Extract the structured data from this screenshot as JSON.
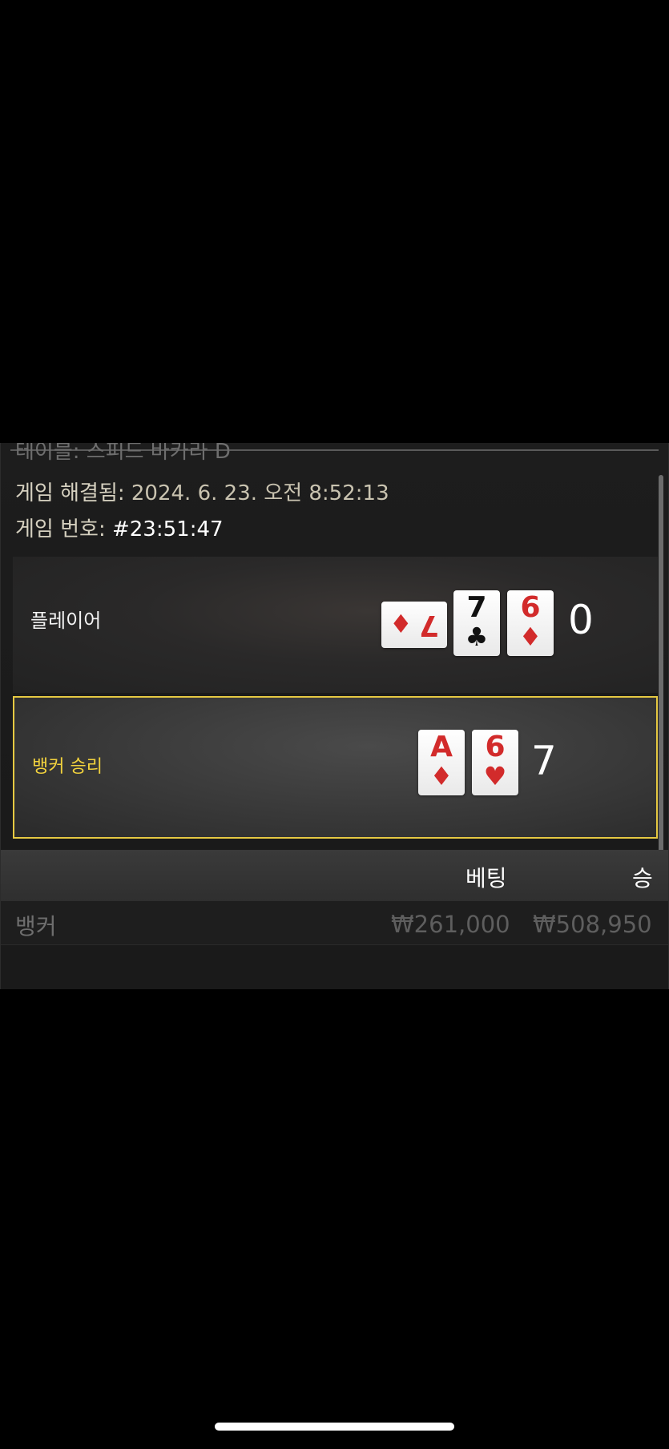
{
  "history": {
    "table_name": "테이블: 스피드 바카라 D",
    "resolved_label": "게임 해결됨:",
    "resolved_value": "2024. 6. 23. 오전 8:52:13",
    "game_label": "게임 번호:",
    "game_value": "#23:51:47"
  },
  "player": {
    "label": "플레이어",
    "score": "0",
    "cards": [
      {
        "rank": "7",
        "suit": "♦",
        "color": "red",
        "orientation": "sideways"
      },
      {
        "rank": "7",
        "suit": "♣",
        "color": "black"
      },
      {
        "rank": "6",
        "suit": "♦",
        "color": "red"
      }
    ]
  },
  "banker": {
    "label": "뱅커 승리",
    "score": "7",
    "highlight_color": "#e6c942",
    "cards": [
      {
        "rank": "A",
        "suit": "♦",
        "color": "red"
      },
      {
        "rank": "6",
        "suit": "♥",
        "color": "red"
      }
    ]
  },
  "bets": {
    "header_bet": "베팅",
    "header_win": "승",
    "rows": [
      {
        "label": "뱅커",
        "bet": "₩261,000",
        "win": "₩508,950"
      }
    ]
  }
}
